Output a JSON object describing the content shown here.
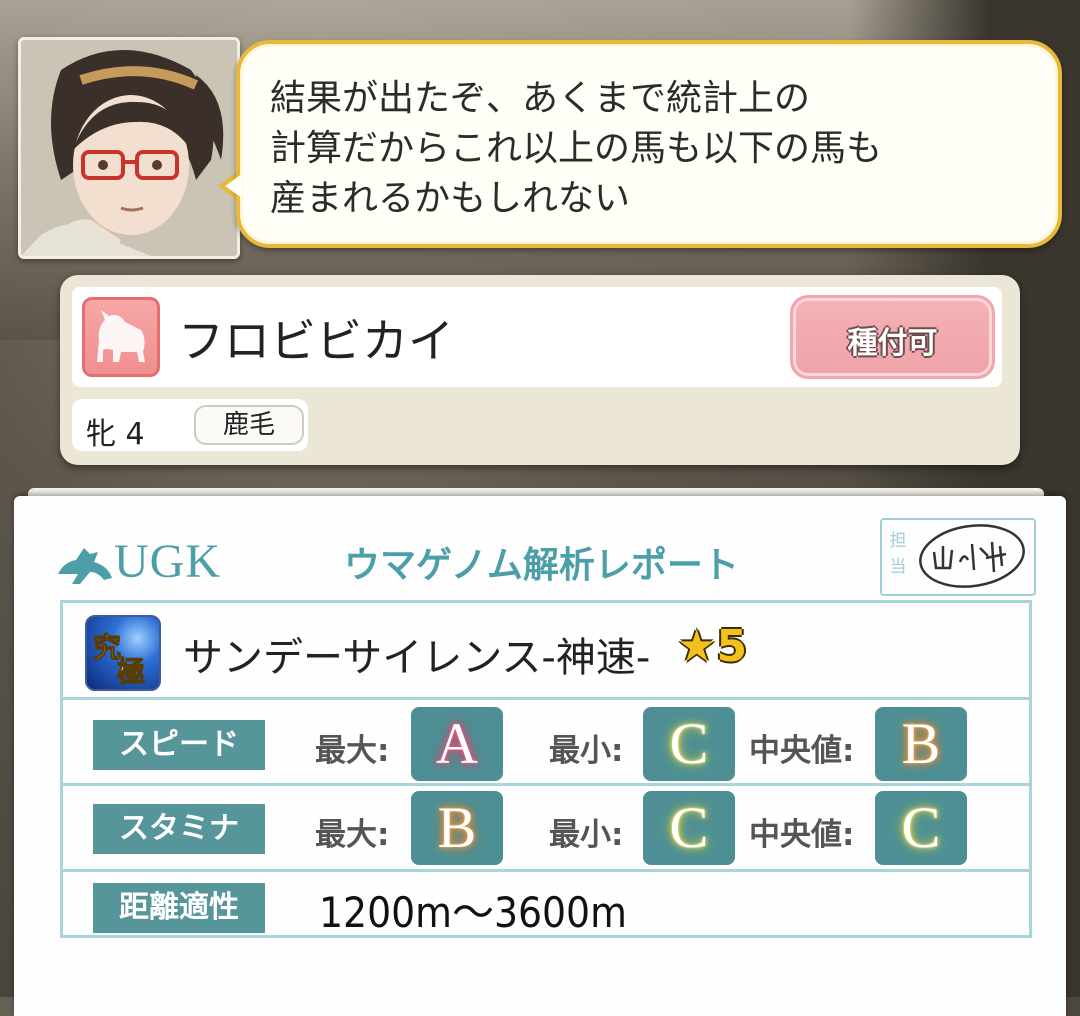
{
  "dialog": {
    "speaker_portrait": "woman-with-glasses-portrait",
    "message": "結果が出たぞ、あくまで統計上の\n計算だからこれ以上の馬も以下の馬も\n産まれるかもしれない"
  },
  "horse": {
    "icon": "horse-mare-icon",
    "name": "フロビビカイ",
    "breed_button": "種付可",
    "sex_age": "牝 4",
    "coat": "鹿毛"
  },
  "report": {
    "logo_text": "UGK",
    "title": "ウマゲノム解析レポート",
    "stamp_label": "担当",
    "stamp_signature": "山科",
    "factor": {
      "icon": "kyuukyoku-factor-icon",
      "name": "サンデーサイレンス-神速-",
      "star_glyph": "★",
      "stars": "5"
    },
    "stats": [
      {
        "label": "スピード",
        "max_key": "最大:",
        "max": "A",
        "min_key": "最小:",
        "min": "C",
        "median_key": "中央値:",
        "median": "B"
      },
      {
        "label": "スタミナ",
        "max_key": "最大:",
        "max": "B",
        "min_key": "最小:",
        "min": "C",
        "median_key": "中央値:",
        "median": "C"
      }
    ],
    "distance": {
      "label": "距離適性",
      "value": "1200m〜3600m"
    }
  },
  "colors": {
    "accent_teal": "#4c9fa8",
    "bubble_border": "#e8b83a",
    "breed_pink": "#f5b2b6"
  }
}
